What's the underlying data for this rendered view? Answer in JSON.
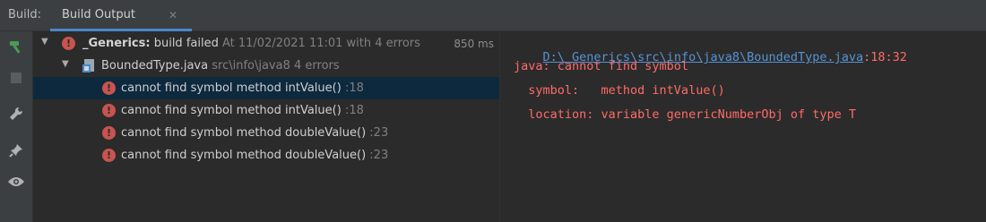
{
  "topbar": {
    "build_label": "Build:",
    "tab_label": "Build Output",
    "close_glyph": "✕"
  },
  "toolbar": {
    "icons": [
      "hammer-icon",
      "stop-icon",
      "wrench-icon",
      "pin-icon",
      "eye-icon"
    ]
  },
  "tree": {
    "root": {
      "name": "_Generics:",
      "status": "build failed",
      "detail": "At 11/02/2021 11:01 with 4 errors",
      "time": "850 ms"
    },
    "file": {
      "name": "BoundedType.java",
      "path": "src\\info\\java8",
      "errors": "4 errors"
    },
    "errors": [
      {
        "text": "cannot find symbol method intValue()",
        "line": ":18"
      },
      {
        "text": "cannot find symbol method intValue()",
        "line": ":18"
      },
      {
        "text": "cannot find symbol method doubleValue()",
        "line": ":23"
      },
      {
        "text": "cannot find symbol method doubleValue()",
        "line": ":23"
      }
    ]
  },
  "console": {
    "link": "D:\\_Generics\\src\\info\\java8\\BoundedType.java",
    "link_suffix": ":18:32",
    "line1": "java: cannot find symbol",
    "line2": "  symbol:   method intValue()",
    "line3": "  location: variable genericNumberObj of type T"
  },
  "colors": {
    "error": "#c75450",
    "link": "#5594d5",
    "console_text": "#ff6b68",
    "selection": "#0d293e",
    "tab_accent": "#4a88c7"
  }
}
